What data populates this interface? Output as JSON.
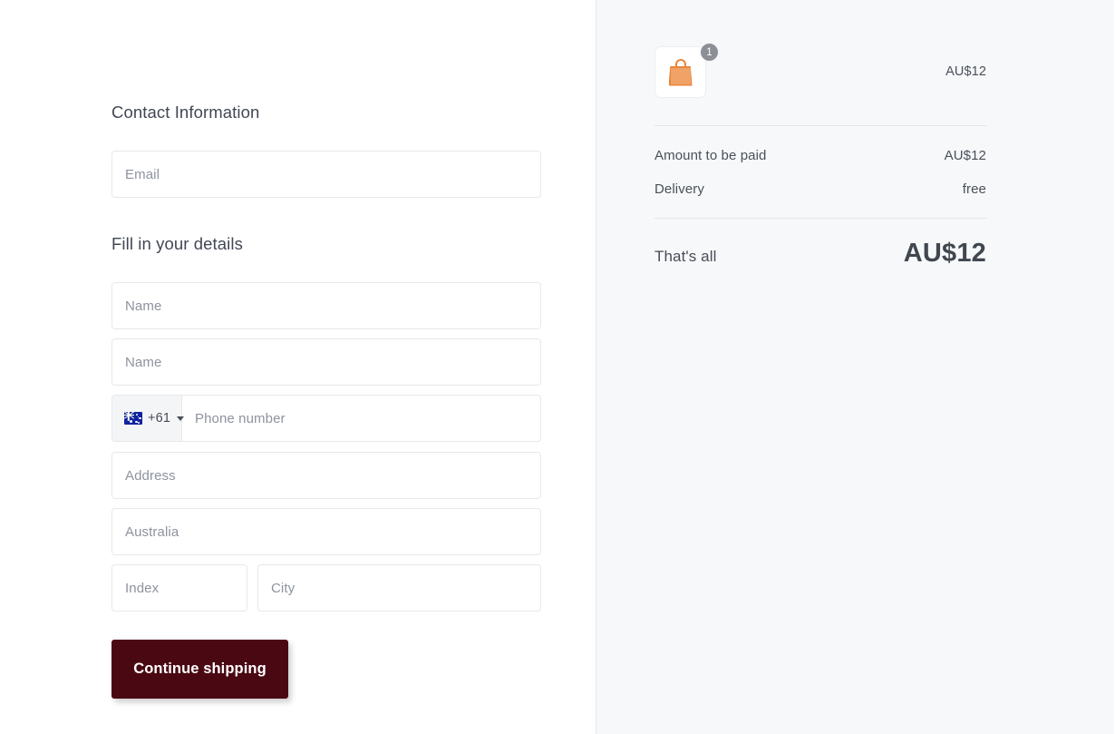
{
  "form": {
    "contact_title": "Contact Information",
    "email_placeholder": "Email",
    "details_title": "Fill in your details",
    "first_name_placeholder": "Name",
    "last_name_placeholder": "Name",
    "phone": {
      "flag": "australia-flag-icon",
      "dial_code": "+61",
      "placeholder": "Phone number"
    },
    "address_placeholder": "Address",
    "country_value": "Australia",
    "index_placeholder": "Index",
    "city_placeholder": "City",
    "submit_label": "Continue shipping"
  },
  "summary": {
    "item": {
      "icon": "shopping-bag-icon",
      "quantity": "1",
      "price": "AU$12"
    },
    "rows": [
      {
        "label": "Amount to be paid",
        "value": "AU$12"
      },
      {
        "label": "Delivery",
        "value": "free"
      }
    ],
    "total": {
      "label": "That's all",
      "value": "AU$12"
    }
  },
  "colors": {
    "accent": "#4a0812",
    "panel_bg": "#f7f8fa",
    "bag": "#f0a267"
  }
}
